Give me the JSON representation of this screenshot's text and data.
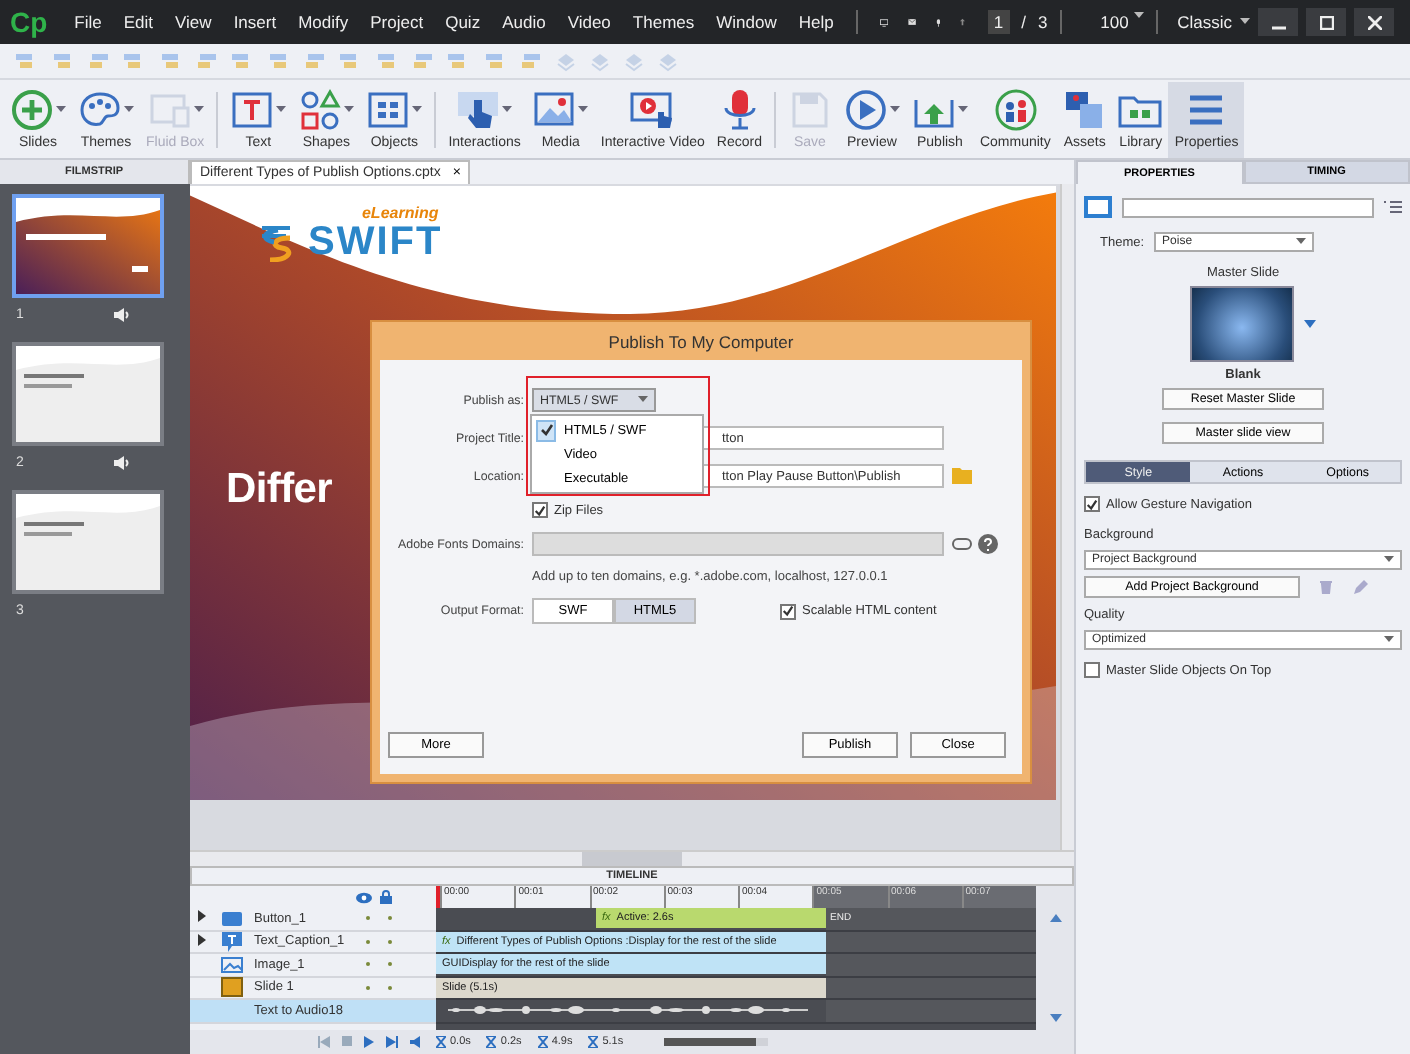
{
  "app": {
    "logo": "Cp"
  },
  "menu": [
    "File",
    "Edit",
    "View",
    "Insert",
    "Modify",
    "Project",
    "Quiz",
    "Audio",
    "Video",
    "Themes",
    "Window",
    "Help"
  ],
  "top_bar": {
    "page": "1",
    "separator": "/",
    "total": "3",
    "zoom": "100",
    "workspace": "Classic"
  },
  "toolbar": [
    {
      "label": "Slides",
      "kind": "slides",
      "dropdown": true,
      "disabled": false,
      "selected": false
    },
    {
      "label": "Themes",
      "kind": "themes",
      "dropdown": true,
      "disabled": false,
      "selected": false
    },
    {
      "label": "Fluid Box",
      "kind": "fluidbox",
      "dropdown": true,
      "disabled": true,
      "selected": false,
      "group_end": true
    },
    {
      "label": "Text",
      "kind": "text",
      "dropdown": true,
      "disabled": false,
      "selected": false
    },
    {
      "label": "Shapes",
      "kind": "shapes",
      "dropdown": true,
      "disabled": false,
      "selected": false
    },
    {
      "label": "Objects",
      "kind": "objects",
      "dropdown": true,
      "disabled": false,
      "selected": false,
      "group_end": true
    },
    {
      "label": "Interactions",
      "kind": "interactions",
      "dropdown": true,
      "disabled": false,
      "selected": false
    },
    {
      "label": "Media",
      "kind": "media",
      "dropdown": true,
      "disabled": false,
      "selected": false
    },
    {
      "label": "Interactive Video",
      "kind": "video",
      "dropdown": false,
      "disabled": false,
      "selected": false
    },
    {
      "label": "Record",
      "kind": "record",
      "dropdown": false,
      "disabled": false,
      "selected": false,
      "group_end": true
    },
    {
      "label": "Save",
      "kind": "save",
      "dropdown": false,
      "disabled": true,
      "selected": false
    },
    {
      "label": "Preview",
      "kind": "preview",
      "dropdown": true,
      "disabled": false,
      "selected": false
    },
    {
      "label": "Publish",
      "kind": "publish",
      "dropdown": true,
      "disabled": false,
      "selected": false
    },
    {
      "label": "Community",
      "kind": "community",
      "dropdown": false,
      "disabled": false,
      "selected": false
    },
    {
      "label": "Assets",
      "kind": "assets",
      "dropdown": false,
      "disabled": false,
      "selected": false
    },
    {
      "label": "Library",
      "kind": "library",
      "dropdown": false,
      "disabled": false,
      "selected": false
    },
    {
      "label": "Properties",
      "kind": "properties",
      "dropdown": false,
      "disabled": false,
      "selected": true
    }
  ],
  "filmstrip": {
    "title": "FILMSTRIP",
    "slides": [
      {
        "number": "1",
        "selected": true,
        "audio": true
      },
      {
        "number": "2",
        "selected": false,
        "audio": true
      },
      {
        "number": "3",
        "selected": false,
        "audio": false
      }
    ]
  },
  "document_tab": {
    "title": "Different Types of Publish Options.cptx",
    "close": "×"
  },
  "slide": {
    "logo_text": "SWIFT",
    "logo_tagline": "eLearning",
    "title": "Differ"
  },
  "dialog": {
    "title": "Publish To My Computer",
    "publish_as": {
      "label": "Publish as:",
      "value": "HTML5 / SWF",
      "options": [
        {
          "label": "HTML5 / SWF",
          "selected": true
        },
        {
          "label": "Video",
          "selected": false
        },
        {
          "label": "Executable",
          "selected": false
        }
      ]
    },
    "project_title": {
      "label": "Project Title:",
      "value": "tton"
    },
    "location": {
      "label": "Location:",
      "value": "tton Play Pause Button\\Publish"
    },
    "zip_files": {
      "label": "Zip Files",
      "checked": true
    },
    "fonts_domains": {
      "label": "Adobe Fonts Domains:",
      "hint": "Add up to ten domains, e.g. *.adobe.com, localhost, 127.0.0.1"
    },
    "output_format": {
      "label": "Output Format:",
      "options": [
        {
          "label": "SWF",
          "selected": false
        },
        {
          "label": "HTML5",
          "selected": true
        }
      ]
    },
    "scalable": {
      "label": "Scalable HTML content",
      "checked": true
    },
    "buttons": {
      "more": "More",
      "publish": "Publish",
      "close": "Close"
    }
  },
  "properties": {
    "tabs": [
      {
        "label": "PROPERTIES",
        "selected": true
      },
      {
        "label": "TIMING",
        "selected": false
      }
    ],
    "theme_label": "Theme:",
    "theme": "Poise",
    "master_title": "Master Slide",
    "master_name": "Blank",
    "reset_button": "Reset Master Slide",
    "view_button": "Master slide view",
    "subtabs": [
      {
        "label": "Style",
        "selected": true
      },
      {
        "label": "Actions",
        "selected": false
      },
      {
        "label": "Options",
        "selected": false
      }
    ],
    "gesture": {
      "label": "Allow Gesture Navigation",
      "checked": true
    },
    "background_label": "Background",
    "background": "Project Background",
    "add_background": "Add Project Background",
    "quality_label": "Quality",
    "quality": "Optimized",
    "master_on_top": {
      "label": "Master Slide Objects On Top",
      "checked": false
    }
  },
  "timeline": {
    "title": "TIMELINE",
    "ticks": [
      "00:00",
      "00:01",
      "00:02",
      "00:03",
      "00:04",
      "00:05",
      "00:06",
      "00:07"
    ],
    "end_label": "END",
    "rows": [
      {
        "name": "Button_1",
        "kind": "button",
        "expandable": true,
        "selected": false,
        "fx": "fx",
        "bar": "Active: 2.6s"
      },
      {
        "name": "Text_Caption_1",
        "kind": "caption",
        "expandable": true,
        "selected": false,
        "fx": "fx",
        "bar": "Different Types of Publish Options :Display for the rest of the slide"
      },
      {
        "name": "Image_1",
        "kind": "image",
        "expandable": false,
        "selected": false,
        "bar": "GUIDisplay for the rest of the slide"
      },
      {
        "name": "Slide 1",
        "kind": "slide",
        "expandable": false,
        "selected": false,
        "bar": "Slide (5.1s)"
      },
      {
        "name": "Text to Audio18",
        "kind": "audio",
        "expandable": false,
        "selected": true
      }
    ],
    "readouts": [
      "0.0s",
      "0.2s",
      "4.9s",
      "5.1s"
    ],
    "zoom_slider": {
      "level": 0.9
    }
  }
}
